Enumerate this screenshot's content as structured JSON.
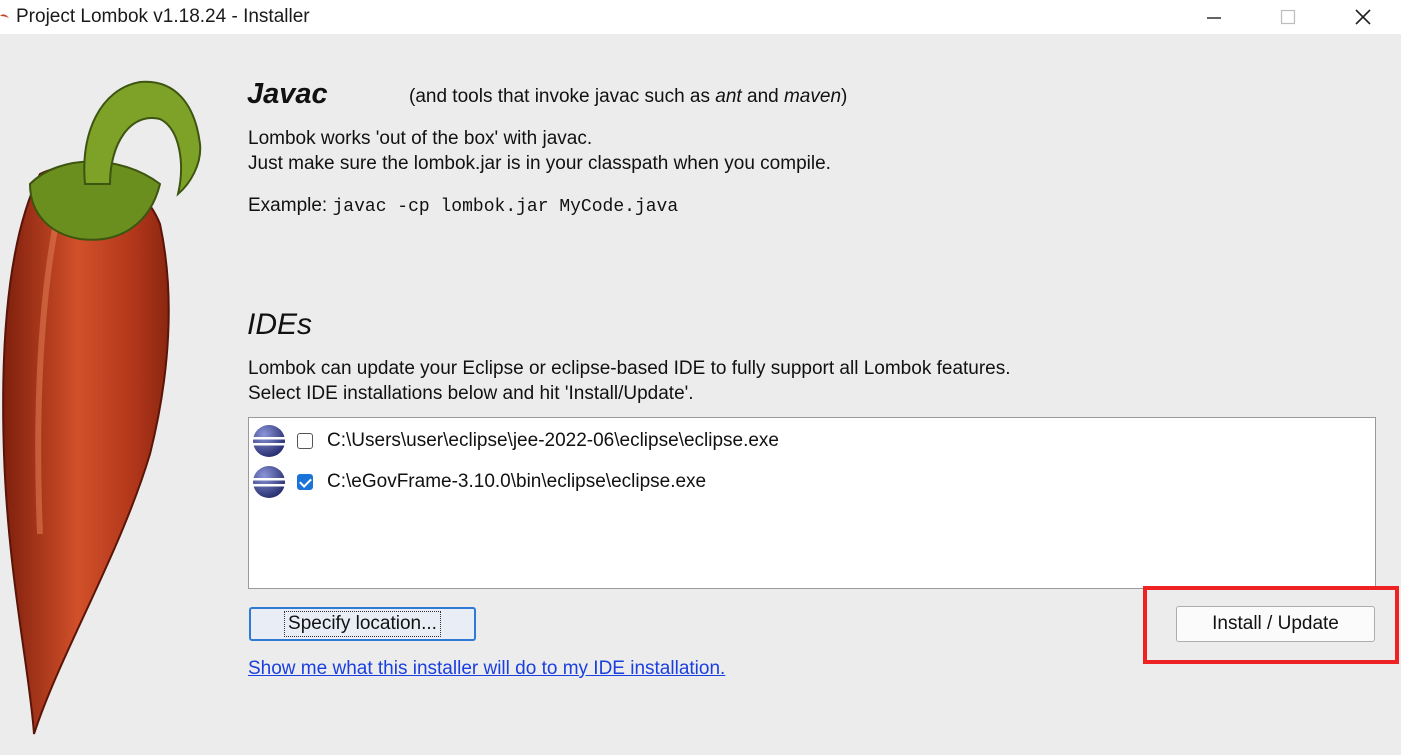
{
  "window": {
    "title": "Project Lombok v1.18.24 - Installer",
    "controls": {
      "minimize": "minimize-icon",
      "maximize": "maximize-icon",
      "close": "close-icon"
    }
  },
  "javac": {
    "title": "Javac",
    "note_prefix": "(and tools that invoke javac such as ",
    "note_ant": "ant",
    "note_and": " and ",
    "note_maven": "maven",
    "note_suffix": ")",
    "line1": "Lombok works 'out of the box' with javac.",
    "line2": "Just make sure the lombok.jar is in your classpath when you compile.",
    "example_label": "Example: ",
    "example_code": "javac -cp lombok.jar MyCode.java"
  },
  "ides": {
    "title": "IDEs",
    "line1": "Lombok can update your Eclipse or eclipse-based IDE to fully support all Lombok features.",
    "line2": "Select IDE installations below and hit 'Install/Update'.",
    "installations": [
      {
        "path": "C:\\Users\\user\\eclipse\\jee-2022-06\\eclipse\\eclipse.exe",
        "checked": false
      },
      {
        "path": "C:\\eGovFrame-3.10.0\\bin\\eclipse\\eclipse.exe",
        "checked": true
      }
    ]
  },
  "buttons": {
    "specify_location": "Specify location...",
    "install_update": "Install / Update"
  },
  "link": {
    "show_me": "Show me what this installer will do to my IDE installation."
  },
  "colors": {
    "highlight": "#ee2222",
    "link": "#1a3fe0",
    "checkbox_checked": "#1a73d9",
    "pepper_red": "#c8401c",
    "pepper_stem": "#6a8f1e"
  }
}
